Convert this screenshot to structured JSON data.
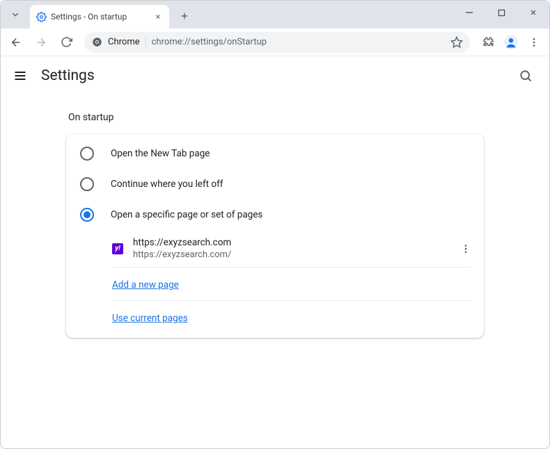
{
  "window": {
    "tab_title": "Settings - On startup"
  },
  "toolbar": {
    "origin_label": "Chrome",
    "url": "chrome://settings/onStartup"
  },
  "header": {
    "title": "Settings"
  },
  "section": {
    "label": "On startup",
    "options": [
      {
        "label": "Open the New Tab page",
        "selected": false
      },
      {
        "label": "Continue where you left off",
        "selected": false
      },
      {
        "label": "Open a specific page or set of pages",
        "selected": true
      }
    ],
    "startup_page": {
      "title": "https://exyzsearch.com",
      "url": "https://exyzsearch.com/",
      "favicon_letter": "y!"
    },
    "add_link": "Add a new page",
    "use_current_link": "Use current pages"
  }
}
